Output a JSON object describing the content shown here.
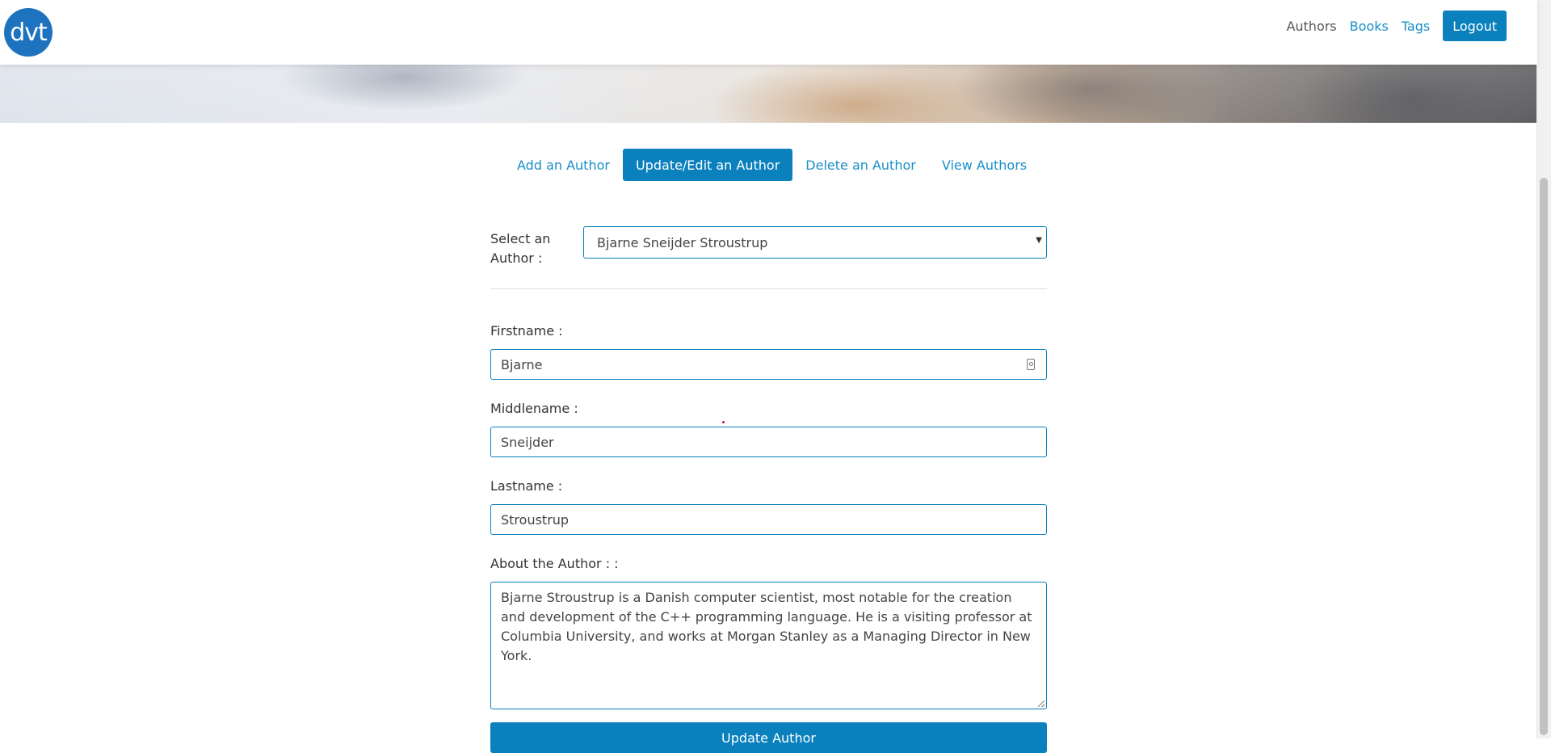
{
  "brand": {
    "logo_text": "dvt"
  },
  "nav": {
    "links": [
      "Authors",
      "Books",
      "Tags"
    ],
    "logout_label": "Logout"
  },
  "tabs": [
    "Add an Author",
    "Update/Edit an Author",
    "Delete an Author",
    "View Authors"
  ],
  "form": {
    "select_label": "Select an Author :",
    "selected_author": "Bjarne Sneijder Stroustrup",
    "firstname_label": "Firstname :",
    "firstname_value": "Bjarne",
    "middlename_label": "Middlename :",
    "middlename_value": "Sneijder",
    "lastname_label": "Lastname :",
    "lastname_value": "Stroustrup",
    "about_label": "About the Author : :",
    "about_value": "Bjarne Stroustrup is a Danish computer scientist, most notable for the creation and development of the C++ programming language. He is a visiting professor at Columbia University, and works at Morgan Stanley as a Managing Director in New York.",
    "submit_label": "Update Author"
  },
  "colors": {
    "primary": "#0a80bd",
    "link": "#1a8fc7"
  }
}
